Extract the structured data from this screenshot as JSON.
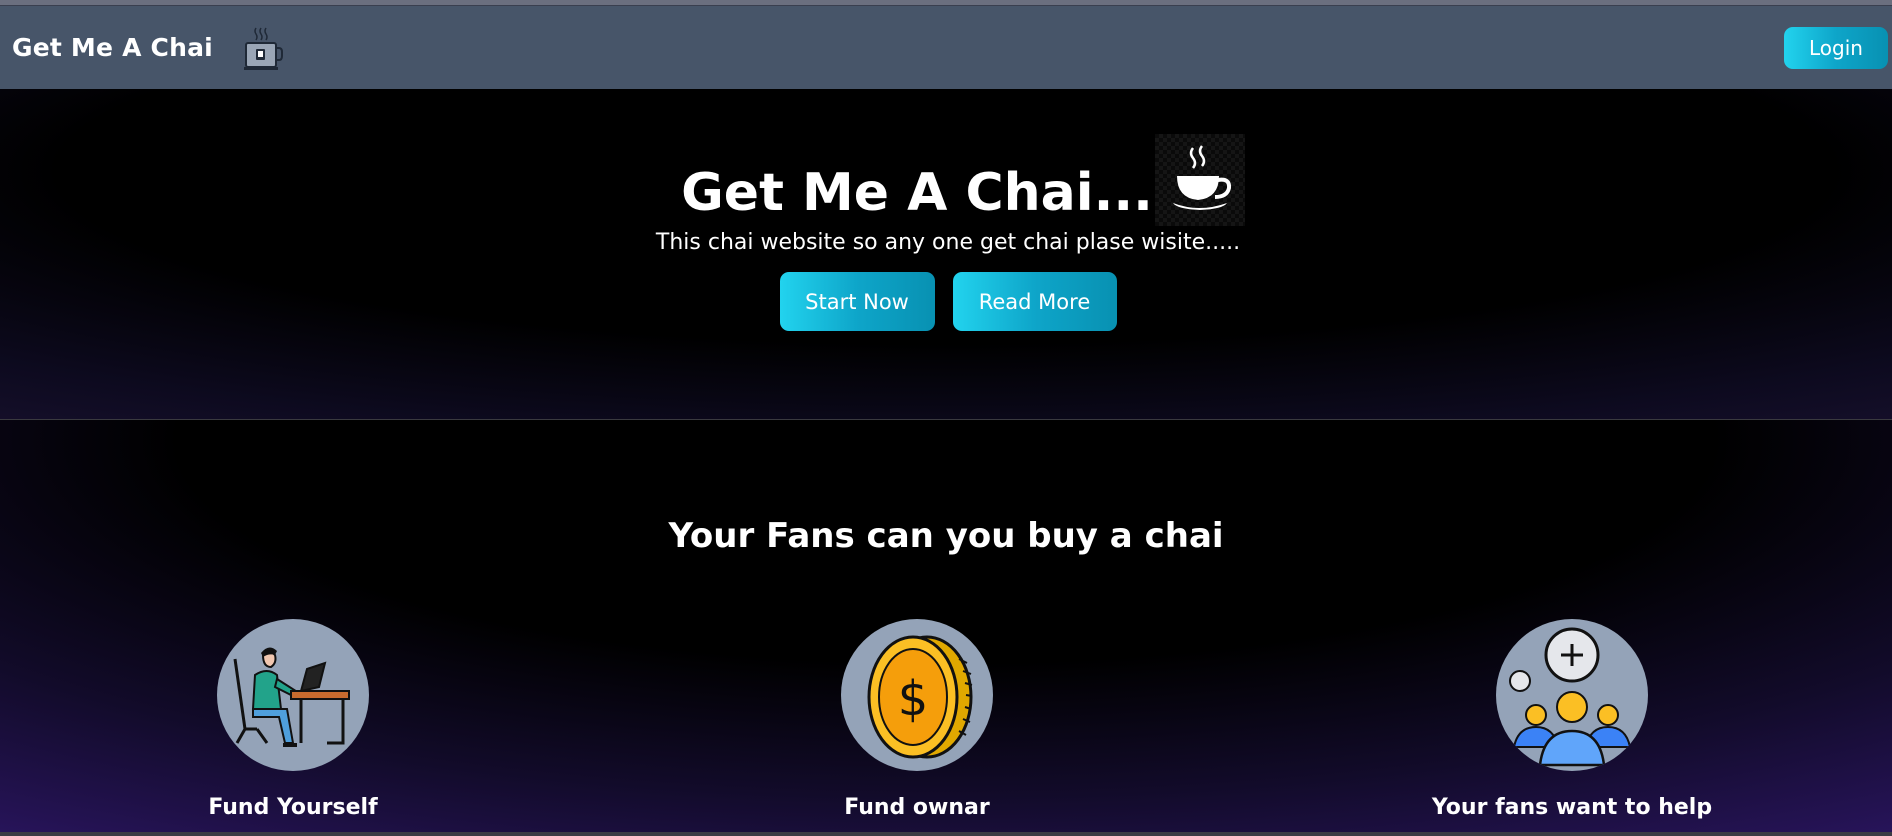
{
  "nav": {
    "brand": "Get Me A Chai",
    "brand_icon": "tea-cup-icon",
    "login_label": "Login"
  },
  "hero": {
    "title": "Get Me A Chai...",
    "title_icon": "steaming-cup-icon",
    "subtitle": "This chai website so any one get chai plase wisite.....",
    "start_label": "Start Now",
    "read_label": "Read More"
  },
  "fans": {
    "title": "Your Fans can you buy a chai",
    "features": [
      {
        "label": "Fund Yourself",
        "icon": "person-at-desk-icon"
      },
      {
        "label": "Fund ownar",
        "icon": "coin-icon"
      },
      {
        "label": "Your fans want to help",
        "icon": "community-icon"
      }
    ]
  },
  "colors": {
    "navbar": "#475569",
    "button_gradient_start": "#22d3ee",
    "button_gradient_end": "#0891b2",
    "icon_circle": "#94a3b8",
    "background_glow": "#2a1560"
  }
}
